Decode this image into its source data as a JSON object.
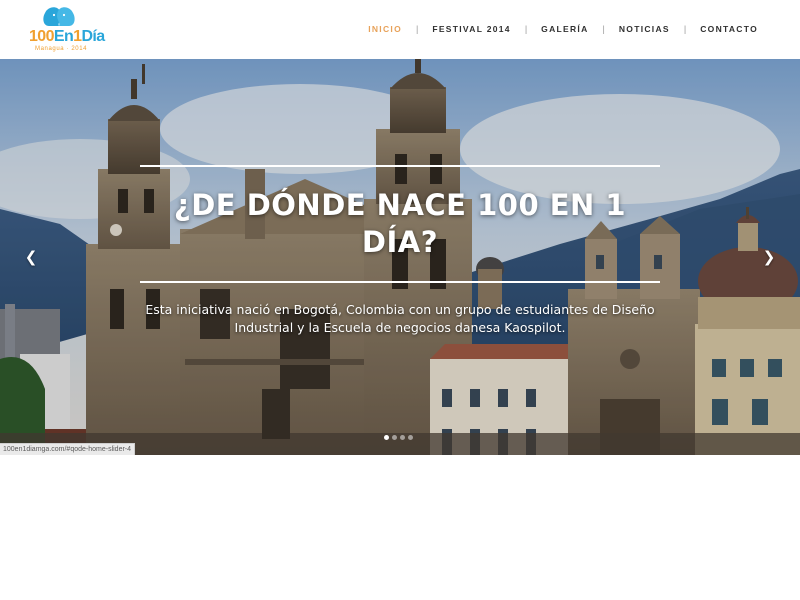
{
  "logo": {
    "word_part1": "100",
    "word_part2": "En",
    "word_part3": "1",
    "word_part4": "Día",
    "subtitle": "Managua · 2014",
    "icon": "two-heads-logo-icon",
    "colors": {
      "orange": "#f0a030",
      "blue": "#2aa6da"
    }
  },
  "nav": {
    "items": [
      {
        "label": "INICIO",
        "active": true
      },
      {
        "label": "FESTIVAL 2014",
        "active": false
      },
      {
        "label": "GALERÍA",
        "active": false
      },
      {
        "label": "NOTICIAS",
        "active": false
      },
      {
        "label": "CONTACTO",
        "active": false
      }
    ],
    "separator": "|",
    "active_color": "#e8a25a"
  },
  "slider": {
    "title": "¿DE DÓNDE NACE 100 EN 1 DÍA?",
    "text": "Esta iniciativa nació en Bogotá, Colombia con un grupo de estudiantes de Diseño Industrial y la Escuela de negocios danesa Kaospilot.",
    "prev_icon": "chevron-left-icon",
    "next_icon": "chevron-right-icon",
    "prev_glyph": "❮",
    "next_glyph": "❯",
    "slide_count": 4,
    "active_slide": 1
  },
  "status_bar": {
    "url": "100en1diamga.com/#qode-home-slider-4"
  }
}
